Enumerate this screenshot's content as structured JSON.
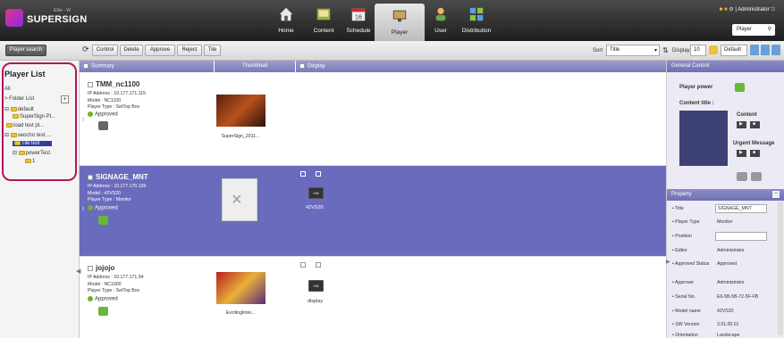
{
  "app": {
    "logo_text": "SUPERSIGN",
    "edition": "Elite - W"
  },
  "nav": [
    {
      "label": "Home",
      "icon": "home-icon"
    },
    {
      "label": "Content",
      "icon": "content-icon"
    },
    {
      "label": "Schedule",
      "icon": "schedule-icon"
    },
    {
      "label": "Player",
      "icon": "player-icon"
    },
    {
      "label": "User",
      "icon": "user-icon"
    },
    {
      "label": "Distribution",
      "icon": "distribution-icon"
    }
  ],
  "header": {
    "user": "| Administrator",
    "player_select": "Player"
  },
  "toolbar": {
    "player_search": "Player search",
    "control": "Control",
    "delete": "Delete",
    "approve": "Approve",
    "reject": "Reject",
    "tile": "Tile",
    "sort_label": "Sort",
    "sort_value": "Title",
    "display_label": "Display",
    "display_count": "10",
    "default_label": "Default"
  },
  "sidebar": {
    "title": "Player List",
    "all": "All",
    "folder_list": "> Folder List",
    "items": [
      "default",
      "SuperSign Pl...",
      "load test pl...",
      "seocho test ...",
      "TileTest",
      "powerTest",
      "1"
    ]
  },
  "columns": {
    "summary": "Summary",
    "thumbnail": "Thumbnail",
    "display": "Display"
  },
  "players": [
    {
      "name": "TMM_nc1100",
      "ip": "IP Address : 10.177.171.115",
      "model": "Model : NC1100",
      "type": "Player Type : SetTop Box",
      "status": "Approved",
      "thumb_caption": "SuperSign_2011..."
    },
    {
      "name": "SIGNAGE_MNT",
      "ip": "IP Address : 10.177.170.106",
      "model": "Model : 42VS20",
      "type": "Player Type : Monitor",
      "status": "Approved",
      "display_caption": "42VS20",
      "monitor_label": "ON"
    },
    {
      "name": "jojojo",
      "ip": "IP Address : 10.177.171.94",
      "model": "Model : NC1000",
      "type": "Player Type : SetTop Box",
      "status": "Approved",
      "thumb_caption": "ExcitingInter...",
      "display_caption": "display",
      "monitor_label": "ON"
    }
  ],
  "right_panel": {
    "general_control": "General Control",
    "player_power": "Player power",
    "content_title": "Content title :",
    "content": "Content",
    "urgent": "Urgent Message",
    "property": "Property",
    "props": [
      {
        "k": "Title",
        "v": "SIGNAGE_MNT"
      },
      {
        "k": "Player Type",
        "v": "Monitor"
      },
      {
        "k": "Position",
        "v": ""
      },
      {
        "k": "Editor",
        "v": "Administrator"
      },
      {
        "k": "Approved Status",
        "v": "Approved"
      },
      {
        "k": "Approver",
        "v": "Administrator"
      },
      {
        "k": "Serial No.",
        "v": "E6-5B-5B-72-5F-FB"
      },
      {
        "k": "Model name",
        "v": "42VS20"
      },
      {
        "k": "SW Version",
        "v": "3.01.00.01"
      },
      {
        "k": "Orientation",
        "v": "Landscape"
      }
    ]
  }
}
